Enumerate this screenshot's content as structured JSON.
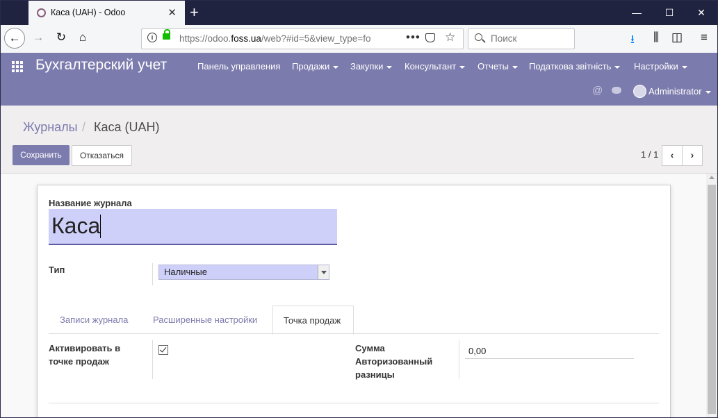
{
  "browser": {
    "tab_title": "Каса (UAH) - Odoo",
    "url_prefix": "https://odoo.",
    "url_domain": "foss.ua",
    "url_suffix": "/web?#id=5&view_type=fo",
    "search_placeholder": "Поиск",
    "accent_color": "#12bc00"
  },
  "odoo": {
    "brand": "Бухгалтерский учет",
    "menu": [
      {
        "label": "Панель управления",
        "dropdown": false
      },
      {
        "label": "Продажи",
        "dropdown": true
      },
      {
        "label": "Закупки",
        "dropdown": true
      },
      {
        "label": "Консультант",
        "dropdown": true
      },
      {
        "label": "Отчеты",
        "dropdown": true
      },
      {
        "label": "Податкова звітність",
        "dropdown": true
      },
      {
        "label": "Настройки",
        "dropdown": true
      }
    ],
    "user": "Administrator",
    "primary_color": "#7c7bad"
  },
  "control_panel": {
    "breadcrumb_parent": "Журналы",
    "breadcrumb_sep": "/",
    "breadcrumb_current": "Каса (UAH)",
    "save_label": "Сохранить",
    "discard_label": "Отказаться",
    "pager": "1 / 1"
  },
  "form": {
    "name_label": "Название журнала",
    "name_value": "Каса",
    "type_label": "Тип",
    "type_value": "Наличные",
    "tabs": [
      "Записи журнала",
      "Расширенные настройки",
      "Точка продаж"
    ],
    "active_tab": "Точка продаж",
    "pos_label_line1": "Активировать в",
    "pos_label_line2": "точке продаж",
    "pos_checked": true,
    "amount_label_line1": "Сумма",
    "amount_label_line2": "Авторизованный",
    "amount_label_line3": "разницы",
    "amount_value": "0,00"
  }
}
